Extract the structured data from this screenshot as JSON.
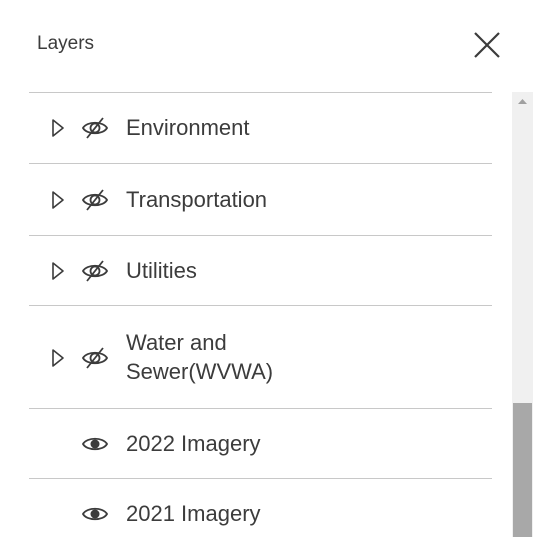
{
  "panel": {
    "title": "Layers",
    "close_icon": "close-icon"
  },
  "layers": [
    {
      "label": "Environment",
      "expandable": true,
      "visible": false
    },
    {
      "label": "Transportation",
      "expandable": true,
      "visible": false
    },
    {
      "label": "Utilities",
      "expandable": true,
      "visible": false
    },
    {
      "label": "Water and Sewer(WVWA)",
      "expandable": true,
      "visible": false
    },
    {
      "label": "2022 Imagery",
      "expandable": false,
      "visible": true
    },
    {
      "label": "2021 Imagery",
      "expandable": false,
      "visible": true
    }
  ],
  "colors": {
    "text": "#3c3c3c",
    "divider": "#c8c8c8",
    "scroll_track": "#f0f0f0",
    "scroll_thumb": "#a8a8a8"
  }
}
